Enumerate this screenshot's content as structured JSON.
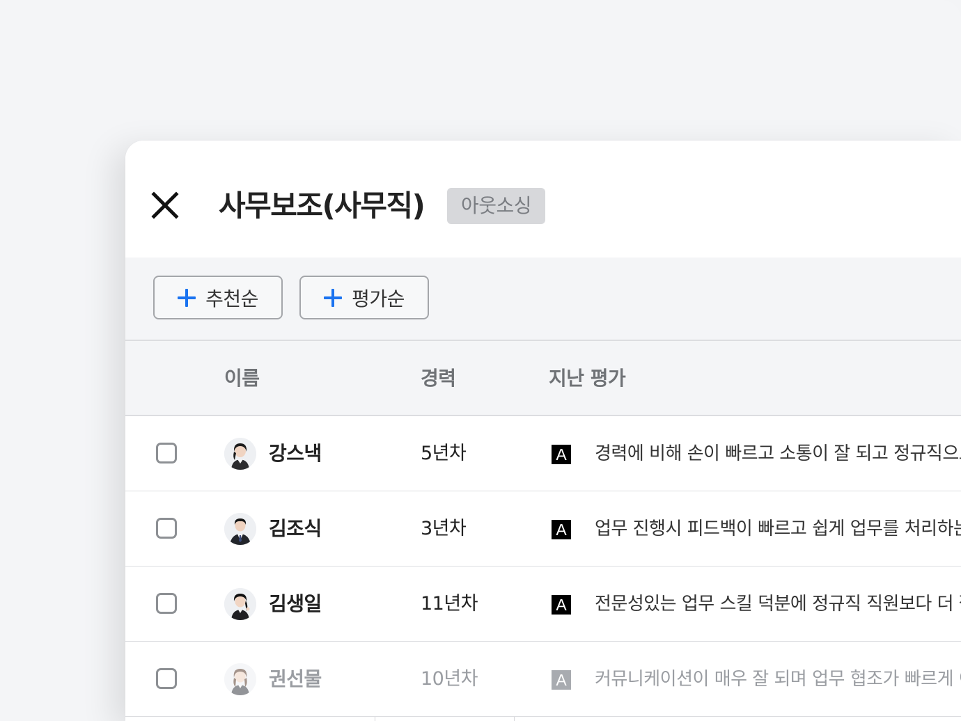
{
  "header": {
    "title": "사무보조(사무직)",
    "badge": "아웃소싱"
  },
  "toolbar": {
    "sort_buttons": [
      {
        "label": "추천순"
      },
      {
        "label": "평가순"
      }
    ]
  },
  "table": {
    "columns": [
      "이름",
      "경력",
      "지난 평가"
    ],
    "rows": [
      {
        "name": "강스낵",
        "experience": "5년차",
        "grade": "A",
        "review": "경력에 비해 손이 빠르고 소통이 잘 되고 정규직으로",
        "dimmed": false
      },
      {
        "name": "김조식",
        "experience": "3년차",
        "grade": "A",
        "review": "업무 진행시 피드백이 빠르고 쉽게 업무를 처리하는",
        "dimmed": false
      },
      {
        "name": "김생일",
        "experience": "11년차",
        "grade": "A",
        "review": "전문성있는 업무 스킬 덕분에 정규직 직원보다 더 잘",
        "dimmed": false
      },
      {
        "name": "권선물",
        "experience": "10년차",
        "grade": "A",
        "review": "커뮤니케이션이 매우 잘 되며 업무 협조가 빠르게 이",
        "dimmed": true
      }
    ]
  },
  "colors": {
    "accent": "#1a73f0",
    "badge_bg": "#d7d8db",
    "toolbar_bg": "#f4f5f7"
  },
  "icons": {
    "close": "close-icon",
    "add": "plus-icon"
  }
}
